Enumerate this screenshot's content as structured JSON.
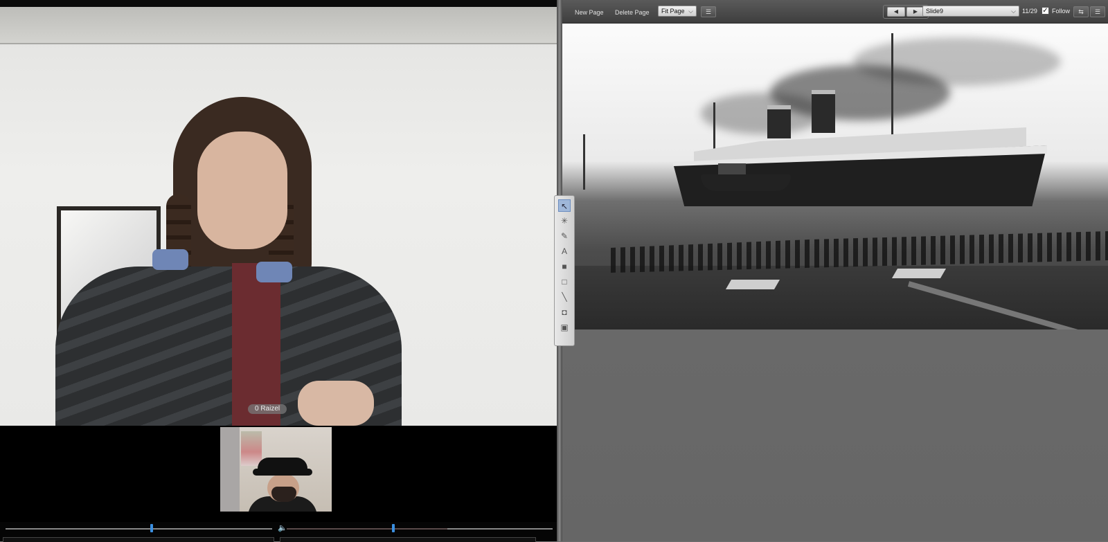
{
  "video": {
    "participant_name": "0 Raizel"
  },
  "whiteboard": {
    "new_page_label": "New Page",
    "delete_page_label": "Delete Page",
    "fit_mode": "Fit Page",
    "slide_name": "Slide9",
    "page_counter": "11/29",
    "follow_label": "Follow",
    "follow_checked": true
  },
  "media_controls": {
    "seek_progress": 0.55,
    "volume_progress": 0.38
  },
  "icons": {
    "prev": "prev-page-icon",
    "next": "next-page-icon",
    "speaker": "speaker-icon",
    "select_tool": "pointer-tool-icon",
    "laser_tool": "laser-pointer-icon",
    "pen_tool": "pen-icon",
    "text_tool": "text-tool-icon",
    "fill_tool": "filled-rect-icon",
    "rect_tool": "rectangle-icon",
    "line_tool": "line-icon",
    "snapshot_tool": "camera-icon",
    "image_tool": "image-icon"
  },
  "colors": {
    "slider_thumb": "#3b8fe0",
    "active_tool": "#9fb7d9"
  }
}
